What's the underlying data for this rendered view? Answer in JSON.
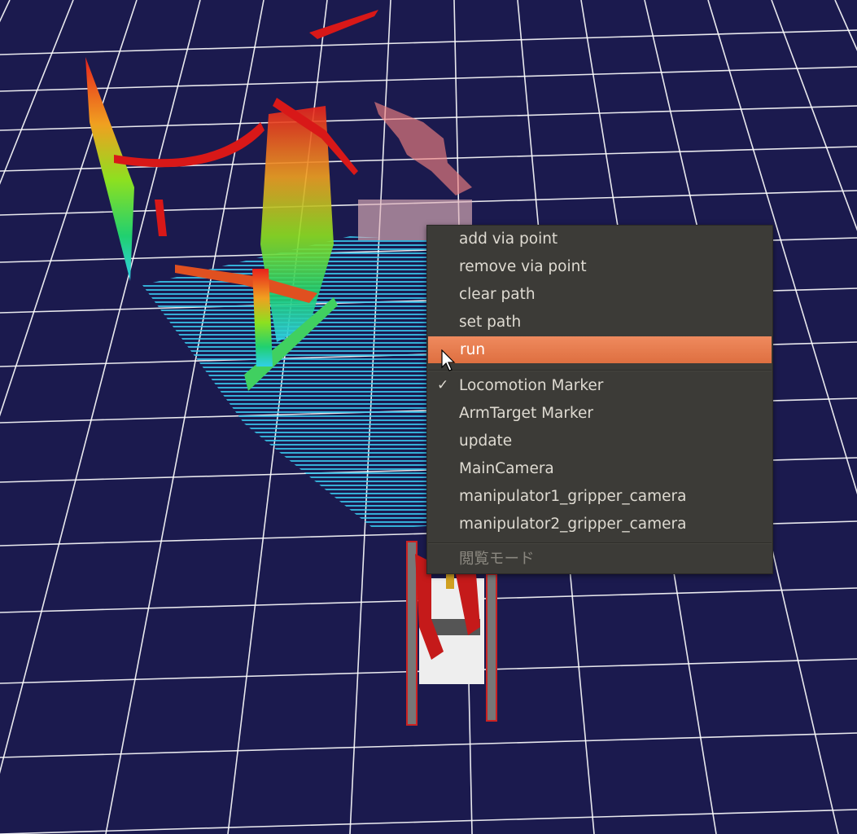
{
  "viewport": {
    "background": "#1b1a4e",
    "grid_color": "#ffffff"
  },
  "context_menu": {
    "items": [
      {
        "label": "add via point",
        "state": "normal"
      },
      {
        "label": "remove via point",
        "state": "normal"
      },
      {
        "label": "clear path",
        "state": "normal"
      },
      {
        "label": "set path",
        "state": "normal"
      },
      {
        "label": "run",
        "state": "highlighted"
      },
      {
        "label": "Locomotion Marker",
        "state": "checked"
      },
      {
        "label": "ArmTarget Marker",
        "state": "normal"
      },
      {
        "label": "update",
        "state": "normal"
      },
      {
        "label": "MainCamera",
        "state": "normal"
      },
      {
        "label": "manipulator1_gripper_camera",
        "state": "normal"
      },
      {
        "label": "manipulator2_gripper_camera",
        "state": "normal"
      },
      {
        "label": "閲覧モード",
        "state": "disabled"
      }
    ],
    "highlight_color": "#e97b4f"
  }
}
